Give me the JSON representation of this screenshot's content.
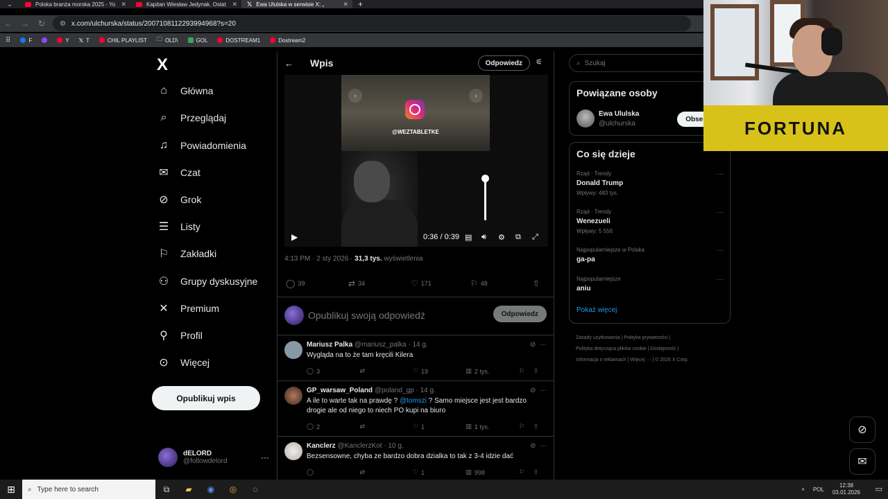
{
  "browser": {
    "tabs": [
      {
        "label": "Polska branża morska 2025 - Yo",
        "icon": "youtube-icon",
        "active": false
      },
      {
        "label": "Kapitan Wiesław Jedynak. Ostat",
        "icon": "youtube-icon",
        "active": false
      },
      {
        "label": "Ewa Ululska w serwisie X: „",
        "icon": "x-icon",
        "active": true
      }
    ],
    "new_tab": "+",
    "url": "x.com/ulchurska/status/2007108112293994968?s=20",
    "bookmarks": [
      {
        "label": "F",
        "color": "#1877f2"
      },
      {
        "label": "",
        "color": "#9146ff"
      },
      {
        "label": "Y",
        "color": "#ff0033"
      },
      {
        "label": "T",
        "color": "#ffffff"
      },
      {
        "label": "CHIL PLAYLIST",
        "color": "#ff0033"
      },
      {
        "label": "OLD\\",
        "color": "#bbbbbb"
      },
      {
        "label": "GOL",
        "color": "#3aa757"
      },
      {
        "label": "DOSTREAM1",
        "color": "#ff0033"
      },
      {
        "label": "Dostream2",
        "color": "#ff0033"
      }
    ]
  },
  "nav": {
    "logo": "X",
    "items": [
      {
        "label": "Główna",
        "icon": "home-icon",
        "glyph": "⌂"
      },
      {
        "label": "Przeglądaj",
        "icon": "search-icon",
        "glyph": "⌕"
      },
      {
        "label": "Powiadomienia",
        "icon": "bell-icon",
        "glyph": "🔔︎"
      },
      {
        "label": "Czat",
        "icon": "mail-icon",
        "glyph": "✉"
      },
      {
        "label": "Grok",
        "icon": "grok-icon",
        "glyph": "⊘"
      },
      {
        "label": "Listy",
        "icon": "list-icon",
        "glyph": "☰"
      },
      {
        "label": "Zakładki",
        "icon": "bookmark-icon",
        "glyph": "⚐"
      },
      {
        "label": "Grupy dyskusyjne",
        "icon": "communities-icon",
        "glyph": "⚇"
      },
      {
        "label": "Premium",
        "icon": "x-premium-icon",
        "glyph": "✕"
      },
      {
        "label": "Profil",
        "icon": "person-icon",
        "glyph": "⚲"
      },
      {
        "label": "Więcej",
        "icon": "more-circle-icon",
        "glyph": "⋯"
      }
    ],
    "post_button": "Opublikuj wpis",
    "account": {
      "name": "dELORD",
      "handle": "@followdelord"
    }
  },
  "post": {
    "header_title": "Wpis",
    "reply_sort": "Odpowiedz",
    "video": {
      "tag": "@WEZTABLETKE",
      "time": "0:36 / 0:39",
      "volume": 1.0
    },
    "time": "4:13 PM · 2 sty 2026 ·",
    "views_value": "31,3 tys.",
    "views_label": "wyświetlenia",
    "stats": {
      "replies": "39",
      "reposts": "34",
      "likes": "171",
      "bookmarks": "48"
    }
  },
  "composer": {
    "placeholder": "Opublikuj swoją odpowiedź",
    "button": "Odpowiedz"
  },
  "replies": [
    {
      "name": "Mariusz Palka",
      "handle": "@mariusz_palka",
      "age": "· 14 g.",
      "text": "Wygląda na to że tam kręcili Kilera",
      "stats": {
        "replies": "3",
        "reposts": "",
        "likes": "19",
        "views": "2 tys."
      }
    },
    {
      "name": "GP_warsaw_Poland",
      "handle": "@poland_gp",
      "age": "· 14 g.",
      "text_before": "A ile to warte tak na prawdę ?",
      "mention": "@tomszi",
      "text_after": "? Samo miejsce jest jest bardzo drogie ale od niego to niech PO kupi na biuro",
      "stats": {
        "replies": "2",
        "reposts": "",
        "likes": "1",
        "views": "1 tys."
      }
    },
    {
      "name": "Kanclerz",
      "handle": "@KanclerzKot",
      "age": "· 10 g.",
      "text": "Bezsensowne, chyba ze bardzo dobra dzialka  to tak z 3-4 idzie dać",
      "stats": {
        "replies": "",
        "reposts": "",
        "likes": "1",
        "views": "998"
      }
    }
  ],
  "sidebar": {
    "search_placeholder": "Szukaj",
    "related": {
      "title": "Powiązane osoby",
      "name": "Ewa Ululska",
      "handle": "@ulchurska",
      "follow": "Obserwuj"
    },
    "trends": {
      "title": "Co się dzieje",
      "items": [
        {
          "category": "Rząd · Trendy",
          "topic": "Donald Trump",
          "posts": "Wpływy: 483 tys."
        },
        {
          "category": "Rząd · Trendy",
          "topic": "Wenezueli",
          "posts": "Wpływy: 5 556"
        },
        {
          "category": "Najpopularniejsze w Polska",
          "topic": "ga-pa",
          "posts": ""
        },
        {
          "category": "Najpopularniejsze",
          "topic": "aniu",
          "posts": ""
        }
      ],
      "show_more": "Pokaż więcej"
    },
    "footer": [
      "Zasady użytkowania",
      "|",
      "Polityka prywatności",
      "|",
      "Polityka dotycząca plików cookie",
      "|",
      "Dostępność",
      "|",
      "Informacja o reklamach",
      "|",
      "Więcej ···",
      "|",
      "© 2026 X Corp."
    ]
  },
  "overlay": {
    "banner_text": "FORTUNA"
  },
  "taskbar": {
    "search_placeholder": "Type here to search",
    "lang": "POL",
    "time": "12:38",
    "date": "03.01.2026"
  }
}
